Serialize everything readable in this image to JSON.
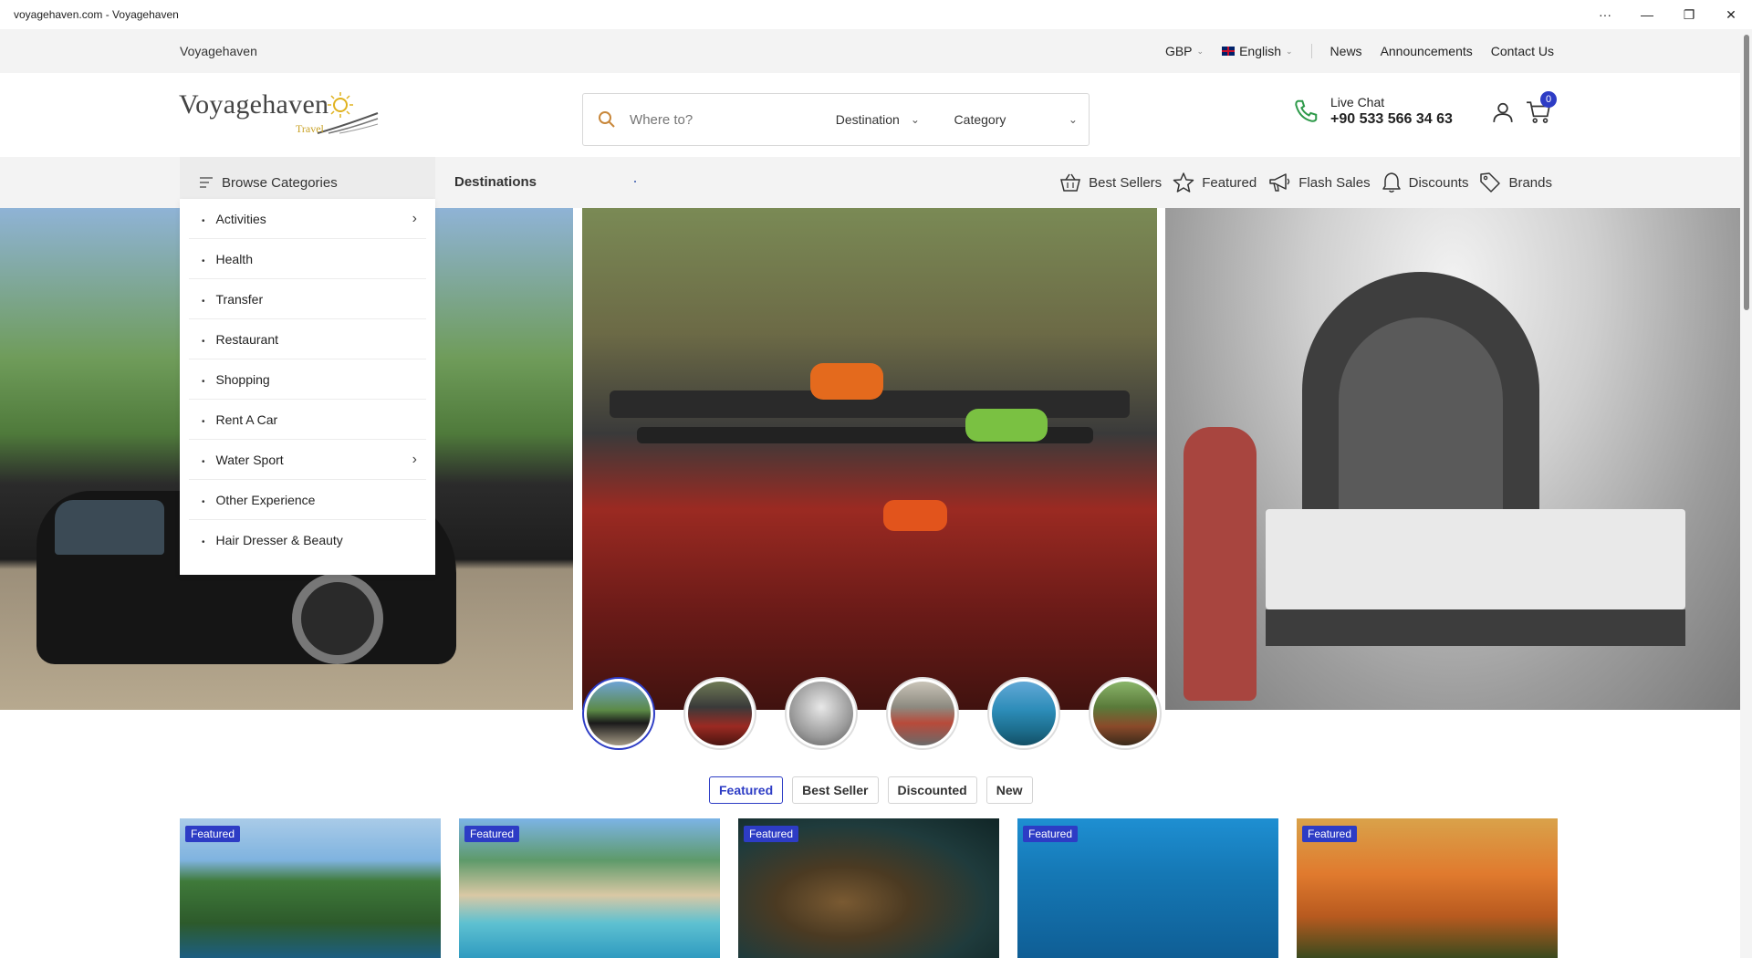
{
  "window": {
    "title": "voyagehaven.com - Voyagehaven"
  },
  "topbar": {
    "brand": "Voyagehaven",
    "currency": "GBP",
    "language": "English",
    "links": [
      "News",
      "Announcements",
      "Contact Us"
    ]
  },
  "header": {
    "logo_text": "Voyagehaven",
    "logo_sub": "Travel",
    "search": {
      "placeholder": "Where to?",
      "destination_label": "Destination",
      "category_label": "Category"
    },
    "contact": {
      "label": "Live Chat",
      "phone": "+90 533 566 34 63"
    },
    "cart_count": "0"
  },
  "nav": {
    "browse_label": "Browse Categories",
    "destinations_label": "Destinations",
    "links": [
      "Best Sellers",
      "Featured",
      "Flash Sales",
      "Discounts",
      "Brands"
    ]
  },
  "categories": [
    {
      "label": "Activities",
      "has_sub": true
    },
    {
      "label": "Health",
      "has_sub": false
    },
    {
      "label": "Transfer",
      "has_sub": false
    },
    {
      "label": "Restaurant",
      "has_sub": false
    },
    {
      "label": "Shopping",
      "has_sub": false
    },
    {
      "label": "Rent A Car",
      "has_sub": false
    },
    {
      "label": "Water Sport",
      "has_sub": true
    },
    {
      "label": "Other Experience",
      "has_sub": false
    },
    {
      "label": "Hair Dresser & Beauty",
      "has_sub": false
    }
  ],
  "tabs": [
    "Featured",
    "Best Seller",
    "Discounted",
    "New"
  ],
  "active_tab": "Featured",
  "cards": [
    {
      "badge": "Featured"
    },
    {
      "badge": "Featured"
    },
    {
      "badge": "Featured"
    },
    {
      "badge": "Featured"
    },
    {
      "badge": "Featured"
    }
  ],
  "colors": {
    "accent": "#2d3cc5",
    "topbar_bg": "#f3f3f3",
    "phone_icon": "#2e9a4a",
    "logo_gold": "#c9a227"
  }
}
